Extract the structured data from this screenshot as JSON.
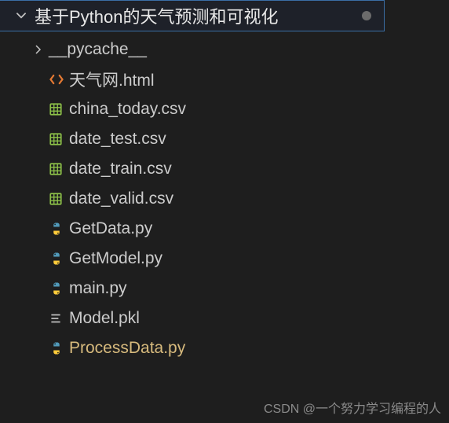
{
  "root": {
    "label": "基于Python的天气预测和可视化",
    "expanded": true,
    "modified": true
  },
  "items": [
    {
      "type": "folder",
      "name": "__pycache__",
      "icon": "folder-collapsed"
    },
    {
      "type": "file",
      "name": "天气网.html",
      "icon": "html"
    },
    {
      "type": "file",
      "name": "china_today.csv",
      "icon": "csv"
    },
    {
      "type": "file",
      "name": "date_test.csv",
      "icon": "csv"
    },
    {
      "type": "file",
      "name": "date_train.csv",
      "icon": "csv"
    },
    {
      "type": "file",
      "name": "date_valid.csv",
      "icon": "csv"
    },
    {
      "type": "file",
      "name": "GetData.py",
      "icon": "python"
    },
    {
      "type": "file",
      "name": "GetModel.py",
      "icon": "python"
    },
    {
      "type": "file",
      "name": "main.py",
      "icon": "python"
    },
    {
      "type": "file",
      "name": "Model.pkl",
      "icon": "text"
    },
    {
      "type": "file",
      "name": "ProcessData.py",
      "icon": "python",
      "active": true
    }
  ],
  "watermark": "CSDN @一个努力学习编程的人"
}
